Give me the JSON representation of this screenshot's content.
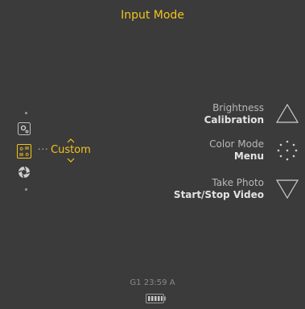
{
  "header": {
    "title": "Input Mode"
  },
  "mode_selector": {
    "selected_label": "Custom",
    "ellipsis": "···",
    "icons": [
      "gear-small-icon",
      "custom-mode-icon",
      "shutter-aperture-icon"
    ]
  },
  "actions": [
    {
      "top": "Brightness",
      "bottom": "Calibration",
      "icon": "triangle-up-icon"
    },
    {
      "top": "Color Mode",
      "bottom": "Menu",
      "icon": "dot-circle-icon"
    },
    {
      "top": "Take Photo",
      "bottom": "Start/Stop Video",
      "icon": "triangle-down-icon"
    }
  ],
  "status": {
    "text": "G1 23:59  A",
    "battery_level": 1.0
  },
  "colors": {
    "accent": "#f3c41c",
    "background": "#3b3b3b"
  }
}
